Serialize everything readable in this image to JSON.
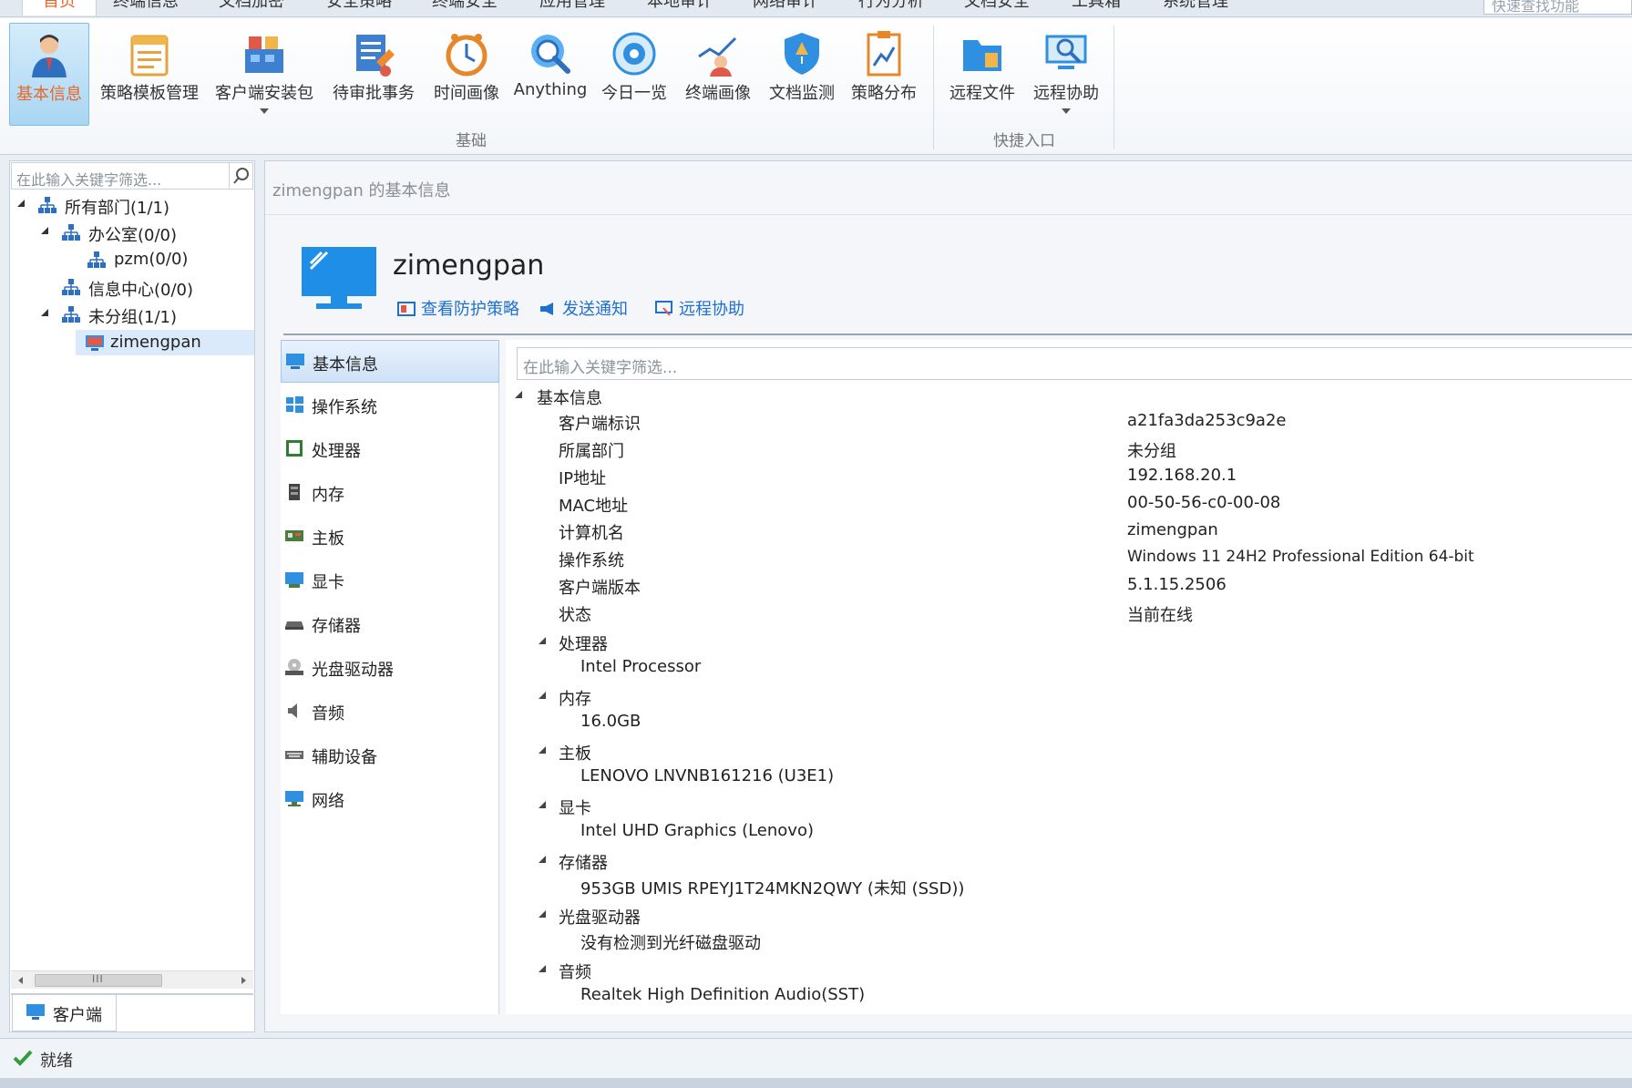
{
  "tabs": [
    "首页",
    "终端信息",
    "文档加密",
    "安全策略",
    "终端安全",
    "应用管理",
    "本地审计",
    "网络审计",
    "行为分析",
    "文档安全",
    "工具箱",
    "系统管理"
  ],
  "quick_search_placeholder": "快速查找功能",
  "ribbon": {
    "buttons": [
      {
        "label": "基本信息",
        "icon": "user-info-icon"
      },
      {
        "label": "策略模板管理",
        "icon": "template-icon"
      },
      {
        "label": "客户端安装包",
        "icon": "package-icon"
      },
      {
        "label": "待审批事务",
        "icon": "approval-icon"
      },
      {
        "label": "时间画像",
        "icon": "clock-icon"
      },
      {
        "label": "Anything",
        "icon": "search-globe-icon"
      },
      {
        "label": "今日一览",
        "icon": "eye-icon"
      },
      {
        "label": "终端画像",
        "icon": "chart-user-icon"
      },
      {
        "label": "文档监测",
        "icon": "shield-icon"
      },
      {
        "label": "策略分布",
        "icon": "clipboard-chart-icon"
      },
      {
        "label": "远程文件",
        "icon": "folder-icon"
      },
      {
        "label": "远程协助",
        "icon": "remote-assist-icon"
      }
    ],
    "groups": [
      "基础",
      "快捷入口"
    ]
  },
  "tree": {
    "search_placeholder": "在此输入关键字筛选...",
    "nodes": [
      "所有部门(1/1)",
      "办公室(0/0)",
      "pzm(0/0)",
      "信息中心(0/0)",
      "未分组(1/1)",
      "zimengpan"
    ],
    "bottom_tab": "客户端"
  },
  "content": {
    "breadcrumb": "zimengpan 的基本信息",
    "hostname": "zimengpan",
    "actions": [
      "查看防护策略",
      "发送通知",
      "远程协助"
    ],
    "nav": [
      "基本信息",
      "操作系统",
      "处理器",
      "内存",
      "主板",
      "显卡",
      "存储器",
      "光盘驱动器",
      "音频",
      "辅助设备",
      "网络"
    ],
    "detail_search_placeholder": "在此输入关键字筛选...",
    "basic_group": "基本信息",
    "basic_rows": [
      {
        "label": "客户端标识",
        "value": "a21fa3da253c9a2e"
      },
      {
        "label": "所属部门",
        "value": "未分组"
      },
      {
        "label": "IP地址",
        "value": "192.168.20.1"
      },
      {
        "label": "MAC地址",
        "value": "00-50-56-c0-00-08"
      },
      {
        "label": "计算机名",
        "value": "zimengpan"
      },
      {
        "label": "操作系统",
        "value": "Windows 11 24H2 Professional Edition 64-bit"
      },
      {
        "label": "客户端版本",
        "value": "5.1.15.2506"
      },
      {
        "label": "状态",
        "value": "当前在线"
      }
    ],
    "hardware": [
      {
        "label": "处理器",
        "value": "Intel Processor"
      },
      {
        "label": "内存",
        "value": "16.0GB"
      },
      {
        "label": "主板",
        "value": "LENOVO LNVNB161216 (U3E1)"
      },
      {
        "label": "显卡",
        "value": "Intel UHD Graphics (Lenovo)"
      },
      {
        "label": "存储器",
        "value": "953GB UMIS RPEYJ1T24MKN2QWY (未知 (SSD))"
      },
      {
        "label": "光盘驱动器",
        "value": "没有检测到光纤磁盘驱动"
      },
      {
        "label": "音频",
        "value": "Realtek High Definition Audio(SST)"
      }
    ]
  },
  "status": "就绪",
  "colors": {
    "accent_orange": "#e8672a",
    "link_blue": "#1e6fd0",
    "selected_bg": "#dbeafa"
  }
}
